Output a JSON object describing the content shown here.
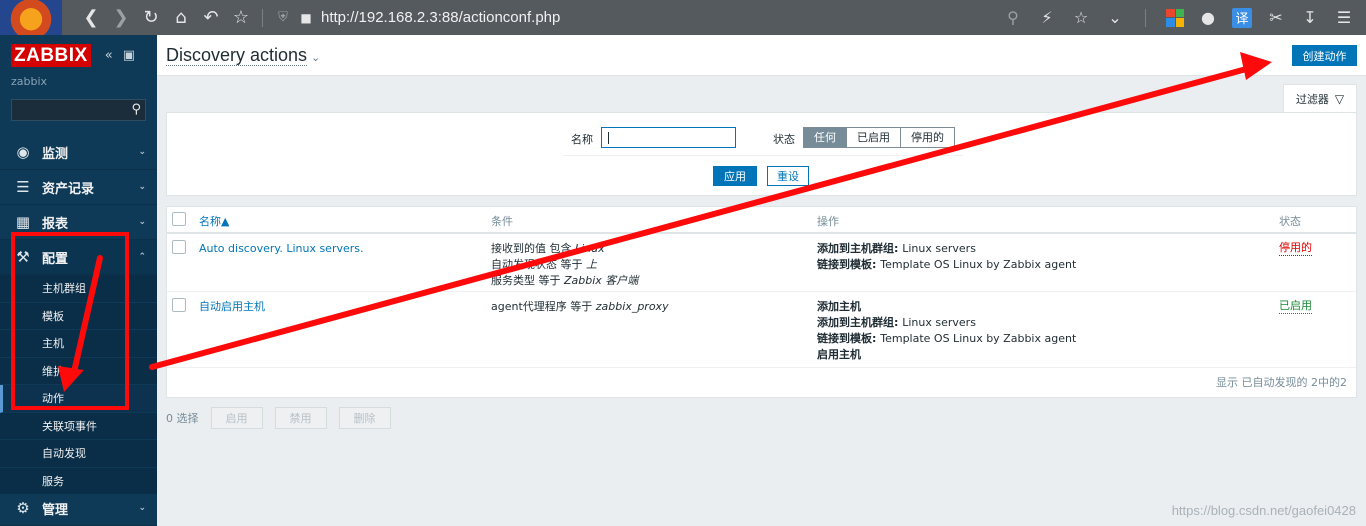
{
  "browser": {
    "url": "http://192.168.2.3:88/actionconf.php",
    "translate_label": "译"
  },
  "sidebar": {
    "logo": "ZABBIX",
    "server": "zabbix",
    "menu": [
      {
        "label": "监测",
        "icon": "eye-icon"
      },
      {
        "label": "资产记录",
        "icon": "list-icon"
      },
      {
        "label": "报表",
        "icon": "chart-icon"
      },
      {
        "label": "配置",
        "icon": "wrench-icon"
      }
    ],
    "config_items": [
      "主机群组",
      "模板",
      "主机",
      "维护",
      "动作",
      "关联项事件",
      "自动发现",
      "服务"
    ],
    "admin_label": "管理"
  },
  "header": {
    "title": "Discovery actions",
    "create_button": "创建动作"
  },
  "filter": {
    "tab_label": "过滤器",
    "name_label": "名称",
    "name_value": "",
    "status_label": "状态",
    "status_options": [
      "任何",
      "已启用",
      "停用的"
    ],
    "status_selected": "任何",
    "apply": "应用",
    "reset": "重设"
  },
  "table": {
    "headers": {
      "name": "名称▲",
      "conditions": "条件",
      "operations": "操作",
      "status": "状态"
    },
    "rows": [
      {
        "name": "Auto discovery. Linux servers.",
        "conditions": [
          {
            "k": "接收到的值 包含 ",
            "v": "Linux"
          },
          {
            "k": "自动发现状态 等于 ",
            "v": "上"
          },
          {
            "k": "服务类型 等于 ",
            "v": "Zabbix 客户端"
          }
        ],
        "operations": [
          {
            "k": "添加到主机群组: ",
            "v": "Linux servers"
          },
          {
            "k": "链接到模板: ",
            "v": "Template OS Linux by Zabbix agent"
          }
        ],
        "status": "停用的"
      },
      {
        "name": "自动启用主机",
        "conditions": [
          {
            "k": "agent代理程序 等于 ",
            "v": "zabbix_proxy"
          }
        ],
        "operations": [
          {
            "k": "添加主机",
            "v": ""
          },
          {
            "k": "添加到主机群组: ",
            "v": "Linux servers"
          },
          {
            "k": "链接到模板: ",
            "v": "Template OS Linux by Zabbix agent"
          },
          {
            "k": "启用主机",
            "v": ""
          }
        ],
        "status": "已启用"
      }
    ],
    "footer": "显示 已自动发现的 2中的2"
  },
  "bulk": {
    "selected": "0 选择",
    "enable": "启用",
    "disable": "禁用",
    "delete": "删除"
  },
  "watermark": "https://blog.csdn.net/gaofei0428",
  "colors": {
    "accent": "#0275b8",
    "sidebar": "#0e3a58",
    "annotation": "#ff0a0a"
  }
}
